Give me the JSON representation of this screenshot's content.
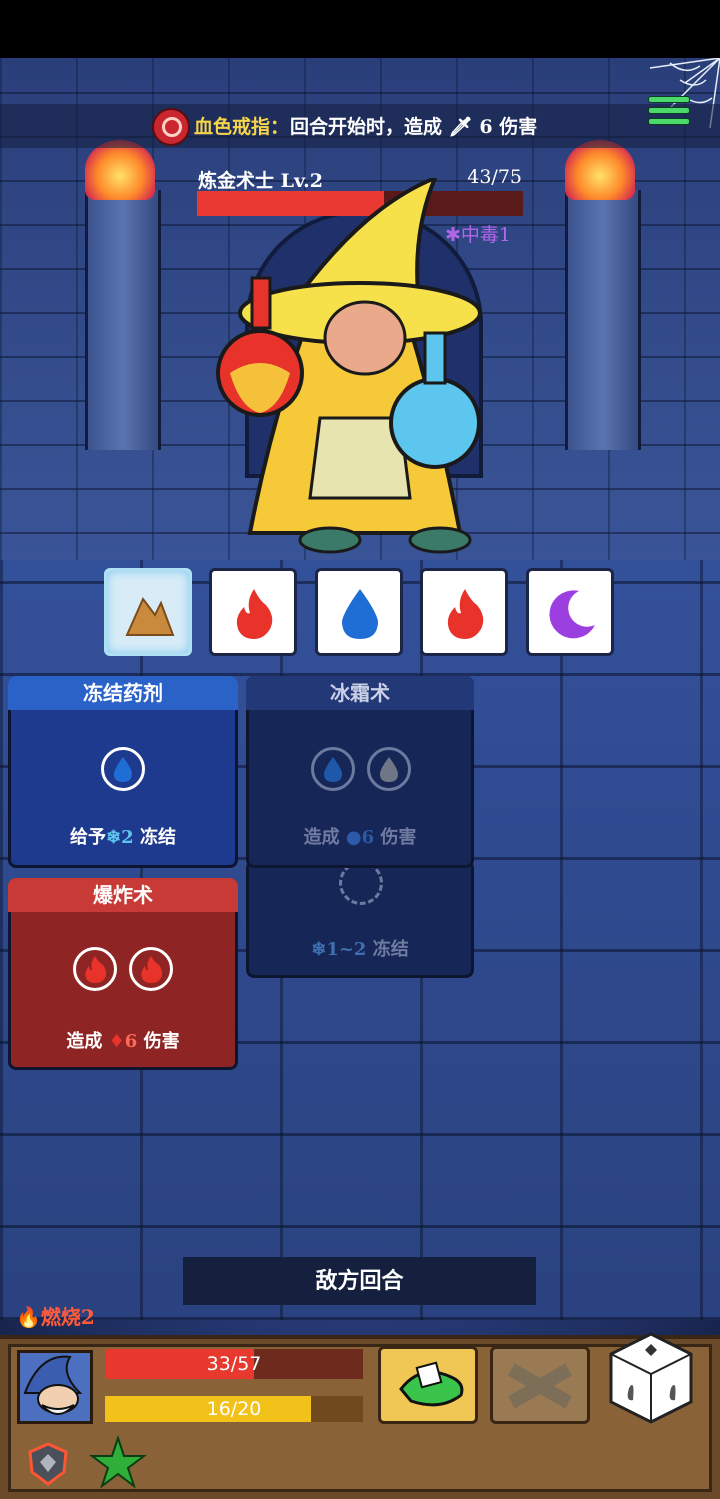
{
  "relic": {
    "icon": "ring-icon",
    "name": "血色戒指：",
    "desc_prefix": "回合开始时，造成",
    "desc_icon": "sword-icon",
    "desc_value": "6",
    "desc_suffix": "伤害"
  },
  "enemy": {
    "name": "炼金术士  Lv.2",
    "hp_text": "43/75",
    "hp_current": 43,
    "hp_max": 75,
    "status": "中毒1",
    "status_icon": "poison-icon"
  },
  "dice": [
    {
      "face": "rock",
      "frozen": true
    },
    {
      "face": "fire",
      "frozen": false
    },
    {
      "face": "water",
      "frozen": false
    },
    {
      "face": "fire",
      "frozen": false
    },
    {
      "face": "moon",
      "frozen": false
    }
  ],
  "cards": {
    "freeze_potion": {
      "title": "冻结药剂",
      "desc_prefix": "给予",
      "desc_value": "2",
      "desc_suffix": "冻结"
    },
    "frost_spell": {
      "title": "冰霜术",
      "desc_prefix": "造成",
      "desc_value": "6",
      "desc_suffix": "伤害",
      "extra_value": "1~2",
      "extra_suffix": "冻结"
    },
    "explosion": {
      "title": "爆炸术",
      "desc_prefix": "造成",
      "desc_value": "6",
      "desc_suffix": "伤害"
    }
  },
  "turn_banner": "敌方回合",
  "player": {
    "status": "燃烧2",
    "hp_text": "33/57",
    "hp_current": 33,
    "hp_max": 57,
    "energy_text": "16/20",
    "energy_current": 16,
    "energy_max": 20
  },
  "colors": {
    "fire": "#e8332b",
    "water": "#1f6ed6",
    "moon": "#9b3fe0",
    "rock": "#c98a3e",
    "gold": "#f6d54a"
  }
}
